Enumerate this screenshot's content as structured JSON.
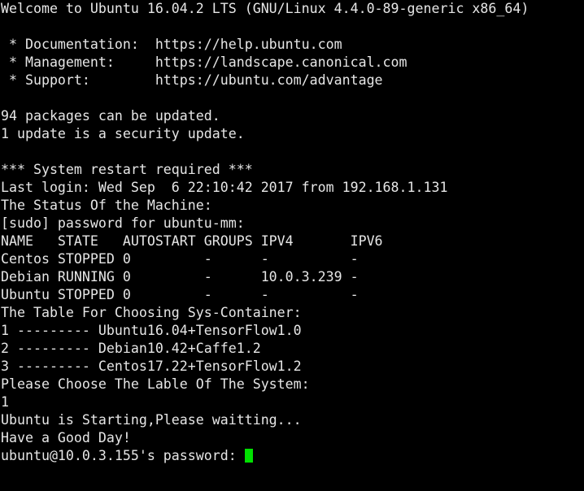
{
  "terminal": {
    "colors": {
      "background": "#000000",
      "foreground": "#e6e6e6",
      "cursor": "#00e000"
    },
    "lines": [
      "Welcome to Ubuntu 16.04.2 LTS (GNU/Linux 4.4.0-89-generic x86_64)",
      "",
      " * Documentation:  https://help.ubuntu.com",
      " * Management:     https://landscape.canonical.com",
      " * Support:        https://ubuntu.com/advantage",
      "",
      "94 packages can be updated.",
      "1 update is a security update.",
      "",
      "*** System restart required ***",
      "Last login: Wed Sep  6 22:10:42 2017 from 192.168.1.131",
      "The Status Of the Machine:",
      "[sudo] password for ubuntu-mm:",
      "NAME   STATE   AUTOSTART GROUPS IPV4       IPV6",
      "Centos STOPPED 0         -      -          -",
      "Debian RUNNING 0         -      10.0.3.239 -",
      "Ubuntu STOPPED 0         -      -          -",
      "The Table For Choosing Sys-Container:",
      "1 --------- Ubuntu16.04+TensorFlow1.0",
      "2 --------- Debian10.42+Caffe1.2",
      "3 --------- Centos17.22+TensorFlow1.2",
      "Please Choose The Lable Of The System:",
      "1",
      "Ubuntu is Starting,Please waitting...",
      "Have a Good Day!"
    ],
    "prompt": {
      "text": "ubuntu@10.0.3.155's password: ",
      "cursor_visible": true
    },
    "container_table": {
      "headers": [
        "NAME",
        "STATE",
        "AUTOSTART",
        "GROUPS",
        "IPV4",
        "IPV6"
      ],
      "rows": [
        [
          "Centos",
          "STOPPED",
          "0",
          "-",
          "-",
          "-"
        ],
        [
          "Debian",
          "RUNNING",
          "0",
          "-",
          "10.0.3.239",
          "-"
        ],
        [
          "Ubuntu",
          "STOPPED",
          "0",
          "-",
          "-",
          "-"
        ]
      ]
    },
    "menu_options": [
      {
        "key": "1",
        "label": "Ubuntu16.04+TensorFlow1.0"
      },
      {
        "key": "2",
        "label": "Debian10.42+Caffe1.2"
      },
      {
        "key": "3",
        "label": "Centos17.22+TensorFlow1.2"
      }
    ],
    "motd": {
      "welcome": "Welcome to Ubuntu 16.04.2 LTS (GNU/Linux 4.4.0-89-generic x86_64)",
      "documentation_label": " * Documentation:",
      "documentation_url": "https://help.ubuntu.com",
      "management_label": " * Management:",
      "management_url": "https://landscape.canonical.com",
      "support_label": " * Support:",
      "support_url": "https://ubuntu.com/advantage",
      "packages_updatable": "94 packages can be updated.",
      "security_updates": "1 update is a security update.",
      "restart_required": "*** System restart required ***",
      "last_login": "Last login: Wed Sep  6 22:10:42 2017 from 192.168.1.131"
    },
    "messages": {
      "status_heading": "The Status Of the Machine:",
      "sudo_prompt": "[sudo] password for ubuntu-mm:",
      "table_heading": "The Table For Choosing Sys-Container:",
      "choose_prompt": "Please Choose The Lable Of The System:",
      "user_choice": "1",
      "starting": "Ubuntu is Starting,Please waitting...",
      "farewell": "Have a Good Day!"
    }
  }
}
